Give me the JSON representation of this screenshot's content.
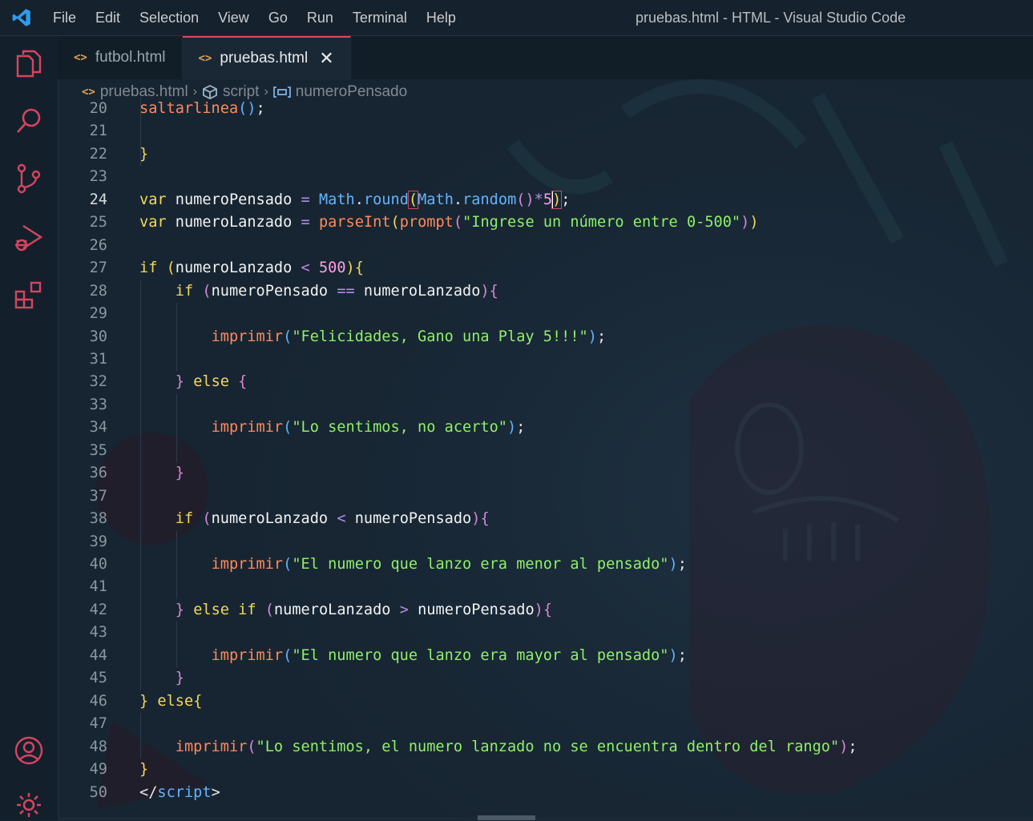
{
  "window": {
    "title": "pruebas.html - HTML - Visual Studio Code",
    "menu": [
      "File",
      "Edit",
      "Selection",
      "View",
      "Go",
      "Run",
      "Terminal",
      "Help"
    ]
  },
  "tabs": [
    {
      "label": "futbol.html",
      "active": false
    },
    {
      "label": "pruebas.html",
      "active": true
    }
  ],
  "breadcrumb": {
    "file": "pruebas.html",
    "section": "script",
    "symbol": "numeroPensado"
  },
  "activity_bar": [
    "explorer-icon",
    "search-icon",
    "source-control-icon",
    "run-debug-icon",
    "extensions-icon",
    "accounts-icon",
    "manage-gear-icon"
  ],
  "colors": {
    "keyword": "#f2d85a",
    "string": "#8ff06a",
    "function": "#ff8a5c",
    "class": "#64b4ff",
    "operator": "#b48be8",
    "number": "#ff9fe0",
    "active_tab_border": "#e0445e"
  },
  "editor": {
    "current_line": "24",
    "lines": [
      {
        "n": "20",
        "tokens": [
          [
            "fn",
            "saltarlinea"
          ],
          [
            "brk3",
            "()"
          ],
          [
            "pun",
            ";"
          ]
        ]
      },
      {
        "n": "21",
        "tokens": []
      },
      {
        "n": "22",
        "tokens": [
          [
            "brk1",
            "}"
          ]
        ]
      },
      {
        "n": "23",
        "tokens": []
      },
      {
        "n": "24",
        "tokens": [
          [
            "kw",
            "var"
          ],
          [
            "pun",
            " "
          ],
          [
            "var",
            "numeroPensado"
          ],
          [
            "pun",
            " "
          ],
          [
            "op",
            "="
          ],
          [
            "pun",
            " "
          ],
          [
            "cls",
            "Math"
          ],
          [
            "pun",
            "."
          ],
          [
            "cls",
            "round"
          ],
          [
            "brk1",
            "("
          ],
          [
            "cls",
            "Math"
          ],
          [
            "pun",
            "."
          ],
          [
            "cls",
            "random"
          ],
          [
            "brk2",
            "()"
          ],
          [
            "op",
            "*"
          ],
          [
            "num",
            "5"
          ],
          [
            "brk1",
            ")"
          ],
          [
            "pun",
            ";"
          ]
        ]
      },
      {
        "n": "25",
        "tokens": [
          [
            "kw",
            "var"
          ],
          [
            "pun",
            " "
          ],
          [
            "var",
            "numeroLanzado"
          ],
          [
            "pun",
            " "
          ],
          [
            "op",
            "="
          ],
          [
            "pun",
            " "
          ],
          [
            "fn",
            "parseInt"
          ],
          [
            "brk1",
            "("
          ],
          [
            "fn",
            "prompt"
          ],
          [
            "brk2",
            "("
          ],
          [
            "str",
            "\"Ingrese un número entre 0-500\""
          ],
          [
            "brk2",
            ")"
          ],
          [
            "brk1",
            ")"
          ]
        ]
      },
      {
        "n": "26",
        "tokens": []
      },
      {
        "n": "27",
        "tokens": [
          [
            "kw",
            "if"
          ],
          [
            "pun",
            " "
          ],
          [
            "brk1",
            "("
          ],
          [
            "var",
            "numeroLanzado"
          ],
          [
            "pun",
            " "
          ],
          [
            "op",
            "<"
          ],
          [
            "pun",
            " "
          ],
          [
            "num",
            "500"
          ],
          [
            "brk1",
            ")"
          ],
          [
            "brk1",
            "{"
          ]
        ]
      },
      {
        "n": "28",
        "tokens": [
          [
            "pun",
            "    "
          ],
          [
            "kw",
            "if"
          ],
          [
            "pun",
            " "
          ],
          [
            "brk2",
            "("
          ],
          [
            "var",
            "numeroPensado"
          ],
          [
            "pun",
            " "
          ],
          [
            "op",
            "=="
          ],
          [
            "pun",
            " "
          ],
          [
            "var",
            "numeroLanzado"
          ],
          [
            "brk2",
            ")"
          ],
          [
            "brk2",
            "{"
          ]
        ]
      },
      {
        "n": "29",
        "tokens": []
      },
      {
        "n": "30",
        "tokens": [
          [
            "pun",
            "        "
          ],
          [
            "fn",
            "imprimir"
          ],
          [
            "brk3",
            "("
          ],
          [
            "str",
            "\"Felicidades, Gano una Play 5!!!\""
          ],
          [
            "brk3",
            ")"
          ],
          [
            "pun",
            ";"
          ]
        ]
      },
      {
        "n": "31",
        "tokens": []
      },
      {
        "n": "32",
        "tokens": [
          [
            "pun",
            "    "
          ],
          [
            "brk2",
            "}"
          ],
          [
            "pun",
            " "
          ],
          [
            "kw",
            "else"
          ],
          [
            "pun",
            " "
          ],
          [
            "brk2",
            "{"
          ]
        ]
      },
      {
        "n": "33",
        "tokens": []
      },
      {
        "n": "34",
        "tokens": [
          [
            "pun",
            "        "
          ],
          [
            "fn",
            "imprimir"
          ],
          [
            "brk3",
            "("
          ],
          [
            "str",
            "\"Lo sentimos, no acerto\""
          ],
          [
            "brk3",
            ")"
          ],
          [
            "pun",
            ";"
          ]
        ]
      },
      {
        "n": "35",
        "tokens": []
      },
      {
        "n": "36",
        "tokens": [
          [
            "pun",
            "    "
          ],
          [
            "brk2",
            "}"
          ]
        ]
      },
      {
        "n": "37",
        "tokens": []
      },
      {
        "n": "38",
        "tokens": [
          [
            "pun",
            "    "
          ],
          [
            "kw",
            "if"
          ],
          [
            "pun",
            " "
          ],
          [
            "brk2",
            "("
          ],
          [
            "var",
            "numeroLanzado"
          ],
          [
            "pun",
            " "
          ],
          [
            "op",
            "<"
          ],
          [
            "pun",
            " "
          ],
          [
            "var",
            "numeroPensado"
          ],
          [
            "brk2",
            ")"
          ],
          [
            "brk2",
            "{"
          ]
        ]
      },
      {
        "n": "39",
        "tokens": []
      },
      {
        "n": "40",
        "tokens": [
          [
            "pun",
            "        "
          ],
          [
            "fn",
            "imprimir"
          ],
          [
            "brk3",
            "("
          ],
          [
            "str",
            "\"El numero que lanzo era menor al pensado\""
          ],
          [
            "brk3",
            ")"
          ],
          [
            "pun",
            ";"
          ]
        ]
      },
      {
        "n": "41",
        "tokens": []
      },
      {
        "n": "42",
        "tokens": [
          [
            "pun",
            "    "
          ],
          [
            "brk2",
            "}"
          ],
          [
            "pun",
            " "
          ],
          [
            "kw",
            "else"
          ],
          [
            "pun",
            " "
          ],
          [
            "kw",
            "if"
          ],
          [
            "pun",
            " "
          ],
          [
            "brk2",
            "("
          ],
          [
            "var",
            "numeroLanzado"
          ],
          [
            "pun",
            " "
          ],
          [
            "op",
            ">"
          ],
          [
            "pun",
            " "
          ],
          [
            "var",
            "numeroPensado"
          ],
          [
            "brk2",
            ")"
          ],
          [
            "brk2",
            "{"
          ]
        ]
      },
      {
        "n": "43",
        "tokens": []
      },
      {
        "n": "44",
        "tokens": [
          [
            "pun",
            "        "
          ],
          [
            "fn",
            "imprimir"
          ],
          [
            "brk3",
            "("
          ],
          [
            "str",
            "\"El numero que lanzo era mayor al pensado\""
          ],
          [
            "brk3",
            ")"
          ],
          [
            "pun",
            ";"
          ]
        ]
      },
      {
        "n": "45",
        "tokens": [
          [
            "pun",
            "    "
          ],
          [
            "brk2",
            "}"
          ]
        ]
      },
      {
        "n": "46",
        "tokens": [
          [
            "brk1",
            "}"
          ],
          [
            "pun",
            " "
          ],
          [
            "kw",
            "else"
          ],
          [
            "brk1",
            "{"
          ]
        ]
      },
      {
        "n": "47",
        "tokens": []
      },
      {
        "n": "48",
        "tokens": [
          [
            "pun",
            "    "
          ],
          [
            "fn",
            "imprimir"
          ],
          [
            "brk2",
            "("
          ],
          [
            "str",
            "\"Lo sentimos, el numero lanzado no se encuentra dentro del rango\""
          ],
          [
            "brk2",
            ")"
          ],
          [
            "pun",
            ";"
          ]
        ]
      },
      {
        "n": "49",
        "tokens": [
          [
            "brk1",
            "}"
          ]
        ]
      },
      {
        "n": "50",
        "tokens": [
          [
            "tag",
            "</"
          ],
          [
            "tagname",
            "script"
          ],
          [
            "tag",
            ">"
          ]
        ]
      }
    ]
  }
}
